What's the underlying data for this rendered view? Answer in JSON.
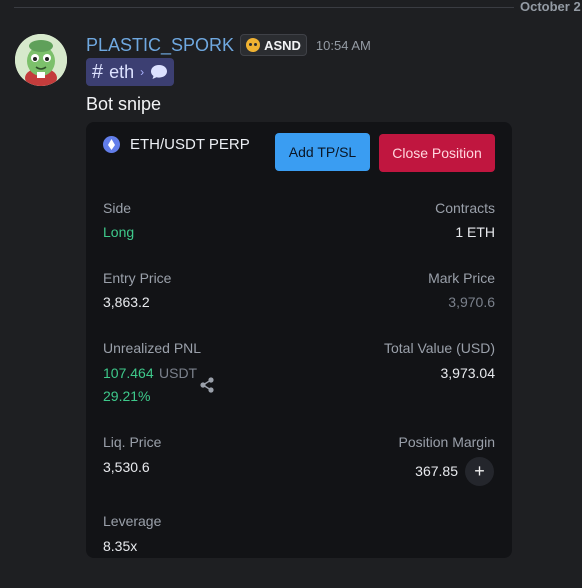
{
  "date_divider": "October 2",
  "message": {
    "username": "PLASTIC_SPORK",
    "tag": "ASND",
    "timestamp": "10:54 AM",
    "channel": "eth",
    "text": "Bot snipe"
  },
  "card": {
    "pair": "ETH/USDT PERP",
    "add_tpsl_label": "Add TP/SL",
    "close_position_label": "Close Position",
    "side_label": "Side",
    "side_value": "Long",
    "contracts_label": "Contracts",
    "contracts_value": "1 ETH",
    "entry_price_label": "Entry Price",
    "entry_price_value": "3,863.2",
    "mark_price_label": "Mark Price",
    "mark_price_value": "3,970.6",
    "unrealized_pnl_label": "Unrealized PNL",
    "unrealized_pnl_value": "107.464",
    "unrealized_pnl_unit": "USDT",
    "unrealized_pnl_percent": "29.21%",
    "total_value_label": "Total Value (USD)",
    "total_value_value": "3,973.04",
    "liq_price_label": "Liq. Price",
    "liq_price_value": "3,530.6",
    "position_margin_label": "Position Margin",
    "position_margin_value": "367.85",
    "plus_label": "+",
    "leverage_label": "Leverage",
    "leverage_value": "8.35x"
  },
  "colors": {
    "username": "#6fa8e0",
    "add_tpsl_bg": "#3a9df2",
    "close_position_bg": "#c0163f",
    "positive": "#3ec98b"
  }
}
